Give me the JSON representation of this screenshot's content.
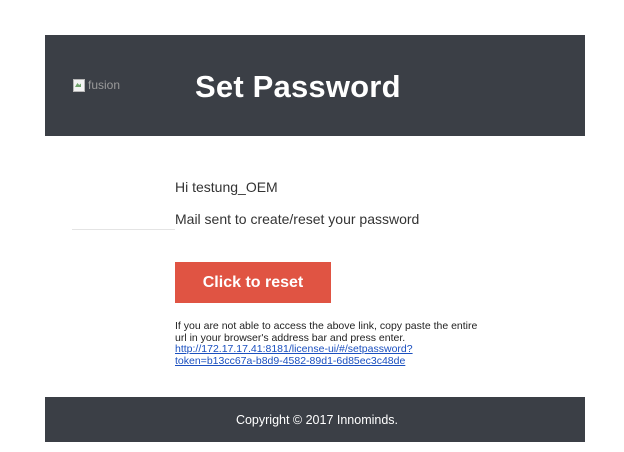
{
  "header": {
    "logo_alt": "fusion",
    "title": "Set Password"
  },
  "body": {
    "greeting": "Hi testung_OEM",
    "message": "Mail sent to create/reset your password",
    "reset_button_label": "Click to reset",
    "note_line1": "If you are not able to access the above link, copy paste the entire",
    "note_line2": "url in your browser's address bar and press enter.",
    "reset_link_line1": "http://172.17.17.41:8181/license-ui/#/setpassword?",
    "reset_link_line2": "token=b13cc67a-b8d9-4582-89d1-6d85ec3c48de"
  },
  "footer": {
    "copyright": "Copyright © 2017 Innominds."
  },
  "colors": {
    "header_bg": "#3b3f46",
    "button_bg": "#e05443",
    "link": "#1a4fbf"
  }
}
